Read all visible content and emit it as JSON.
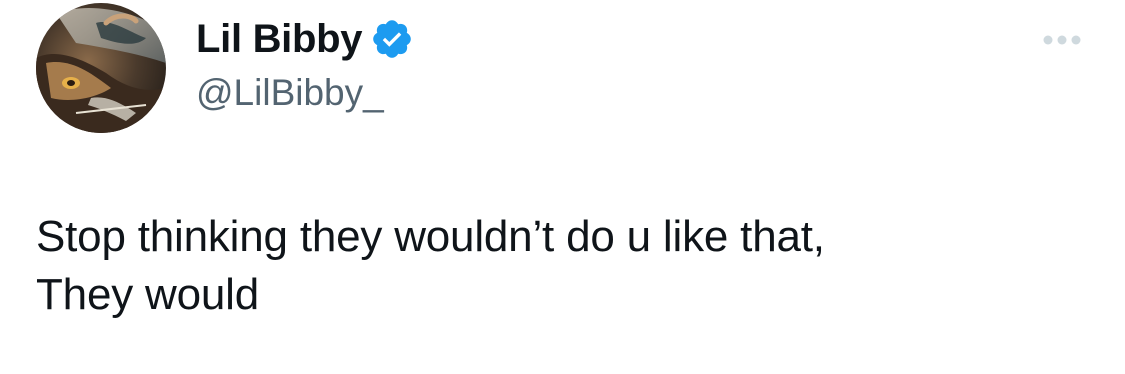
{
  "author": {
    "display_name": "Lil Bibby",
    "handle": "@LilBibby_",
    "verified": true,
    "avatar_icon": "profile-avatar-artwork"
  },
  "colors": {
    "verified_blue": "#1d9bf0",
    "text_primary": "#0f1419",
    "text_secondary": "#536471",
    "more_dots": "#cfd9de"
  },
  "more_icon": "more-horizontal-icon",
  "tweet": {
    "text": "Stop thinking they wouldn’t do u like that,\nThey would"
  }
}
